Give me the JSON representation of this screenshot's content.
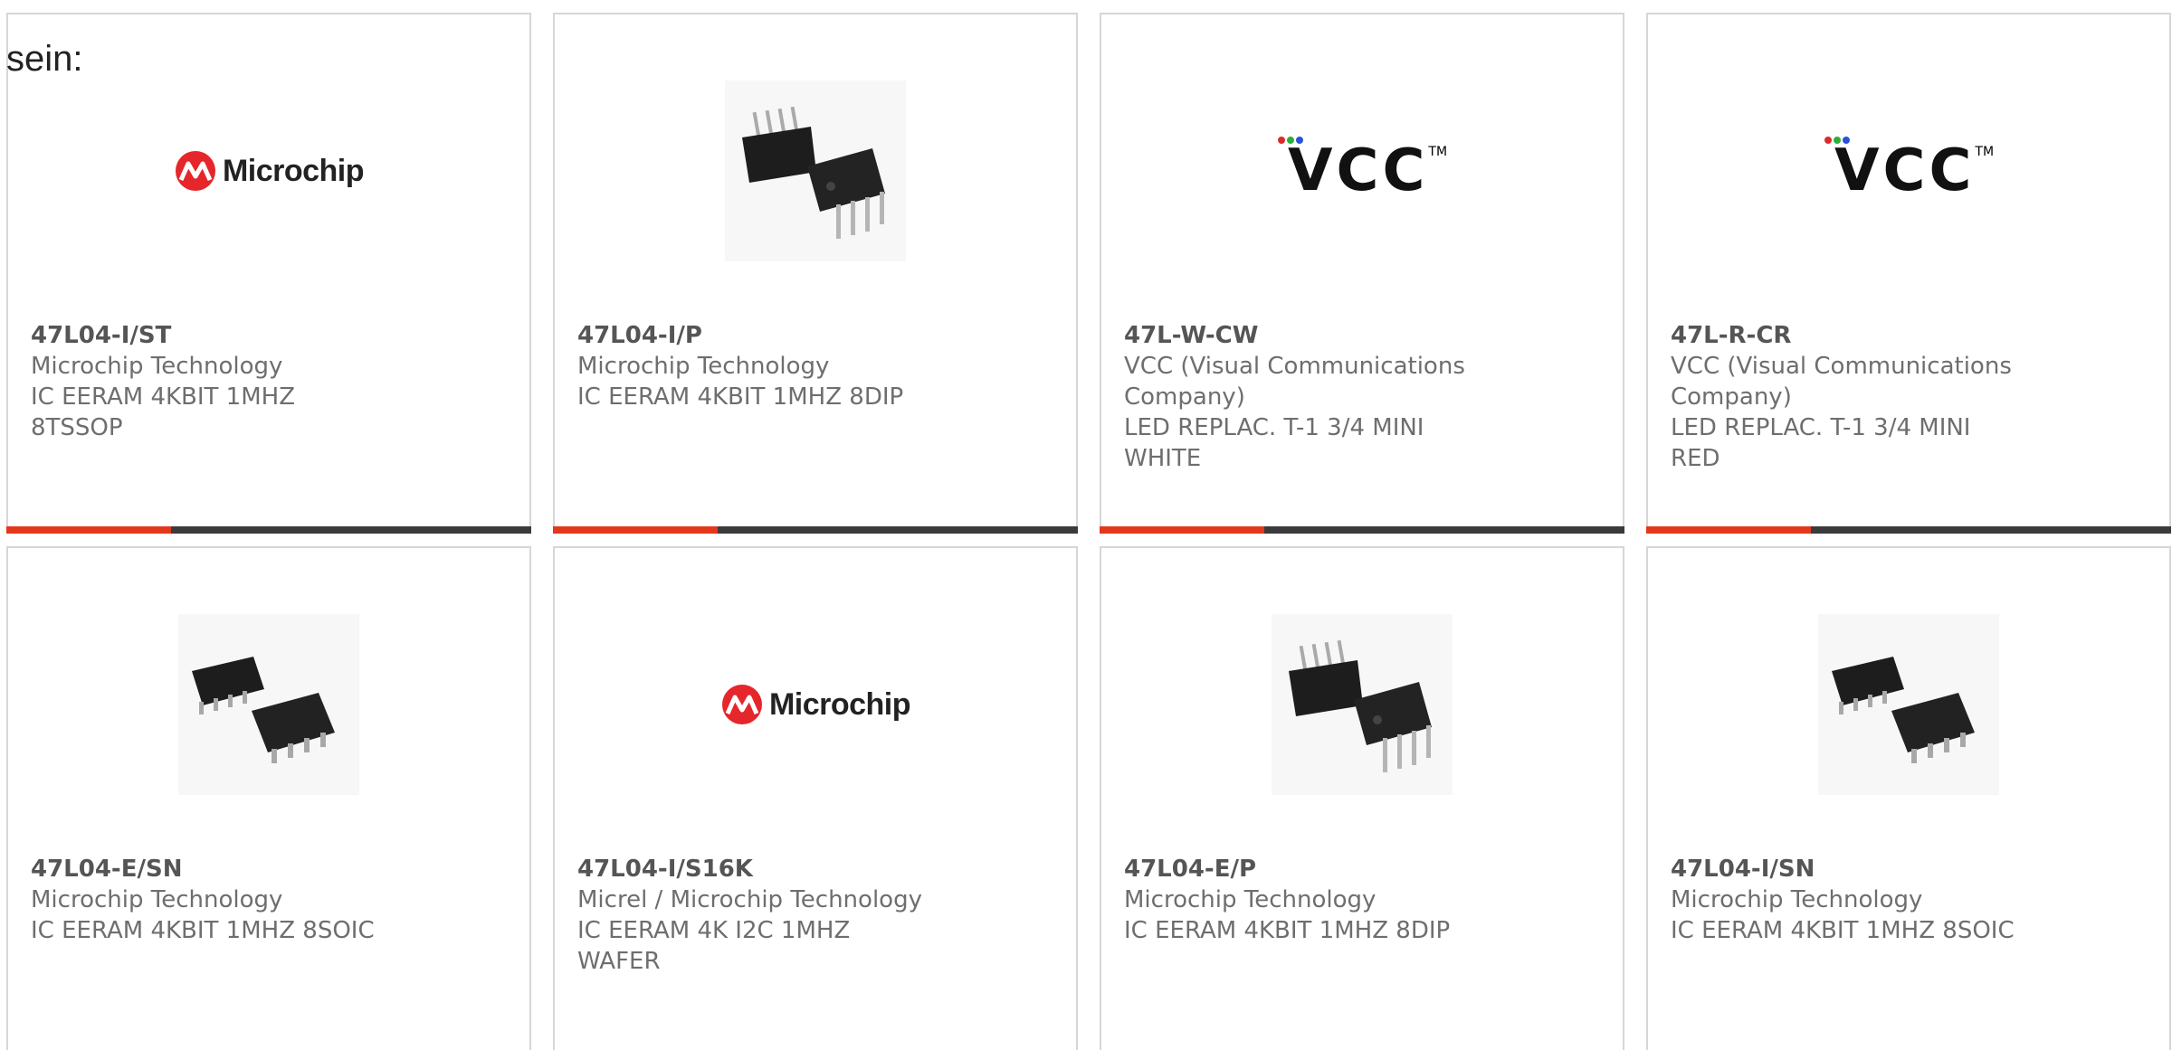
{
  "intro_text": "sein:",
  "colors": {
    "accent": "#e3381c",
    "bar": "#3b3b3b",
    "border": "#d6d6d6"
  },
  "cards": [
    {
      "part_number": "47L04-I/ST",
      "manufacturer": "Microchip Technology",
      "description": "IC EERAM 4KBIT 1MHZ 8TSSOP",
      "image": "microchip-logo"
    },
    {
      "part_number": "47L04-I/P",
      "manufacturer": "Microchip Technology",
      "description": "IC EERAM 4KBIT 1MHZ 8DIP",
      "image": "dip-chip-image"
    },
    {
      "part_number": "47L-W-CW",
      "manufacturer": "VCC (Visual Communications Company)",
      "description": "LED REPLAC. T-1 3/4 MINI WHITE",
      "image": "vcc-logo"
    },
    {
      "part_number": "47L-R-CR",
      "manufacturer": "VCC (Visual Communications Company)",
      "description": "LED REPLAC. T-1 3/4 MINI RED",
      "image": "vcc-logo"
    },
    {
      "part_number": "47L04-E/SN",
      "manufacturer": "Microchip Technology",
      "description": "IC EERAM 4KBIT 1MHZ 8SOIC",
      "image": "soic-chip-image"
    },
    {
      "part_number": "47L04-I/S16K",
      "manufacturer": "Micrel / Microchip Technology",
      "description": "IC EERAM 4K I2C 1MHZ WAFER",
      "image": "microchip-logo"
    },
    {
      "part_number": "47L04-E/P",
      "manufacturer": "Microchip Technology",
      "description": "IC EERAM 4KBIT 1MHZ 8DIP",
      "image": "dip-chip-image"
    },
    {
      "part_number": "47L04-I/SN",
      "manufacturer": "Microchip Technology",
      "description": "IC EERAM 4KBIT 1MHZ 8SOIC",
      "image": "soic-chip-image"
    }
  ],
  "logos": {
    "microchip_text": "Microchip",
    "vcc_text": "VCC",
    "vcc_tm": "TM"
  }
}
